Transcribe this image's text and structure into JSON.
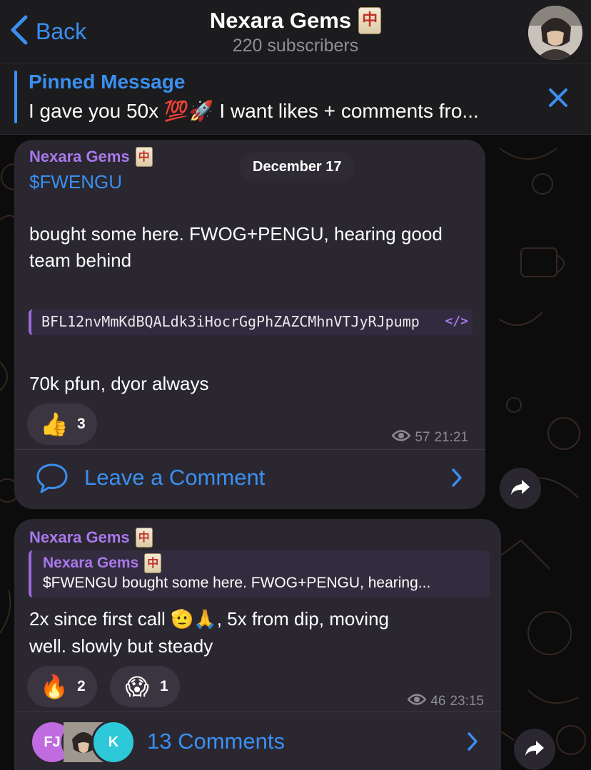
{
  "header": {
    "back_label": "Back",
    "title": "Nexara Gems",
    "title_tile": "中",
    "subtitle": "220 subscribers"
  },
  "pinned": {
    "title": "Pinned Message",
    "text": "I gave you 50x 💯🚀 I want likes + comments fro..."
  },
  "messages": [
    {
      "sender": "Nexara Gems",
      "ticker": "$FWENGU",
      "date": "December 17",
      "body": "bought some here. FWOG+PENGU, hearing good team behind",
      "code": "BFL12nvMmKdBQALdk3iHocrGgPhZAZCMhnVTJyRJpump",
      "code_icon": "</>",
      "footer_text": "70k pfun, dyor always",
      "reactions": [
        {
          "emoji": "👍",
          "count": "3"
        }
      ],
      "views": "57",
      "time": "21:21",
      "comment_label": "Leave a Comment"
    },
    {
      "sender": "Nexara Gems",
      "reply_sender": "Nexara Gems",
      "reply_text": "$FWENGU bought some here. FWOG+PENGU, hearing...",
      "body_line1": "2x since first call 🫡🙏, 5x from dip, moving",
      "body_line2": "well. slowly but steady",
      "reactions": [
        {
          "emoji": "🔥",
          "count": "2"
        },
        {
          "emoji": "😱",
          "count": "1"
        }
      ],
      "views": "46",
      "time": "23:15",
      "comment_label": "13 Comments",
      "commenters": [
        {
          "initials": "FJ"
        },
        {
          "initials": ""
        },
        {
          "initials": "K"
        }
      ]
    }
  ],
  "colors": {
    "accent": "#3b8ff0",
    "sender": "#a978ec",
    "bubble": "#2a2730",
    "header_bg": "#1c1c1e"
  },
  "icons": [
    "chevron-left-icon",
    "close-icon",
    "comment-bubble-icon",
    "chevron-right-icon",
    "share-arrow-icon",
    "eye-icon"
  ]
}
